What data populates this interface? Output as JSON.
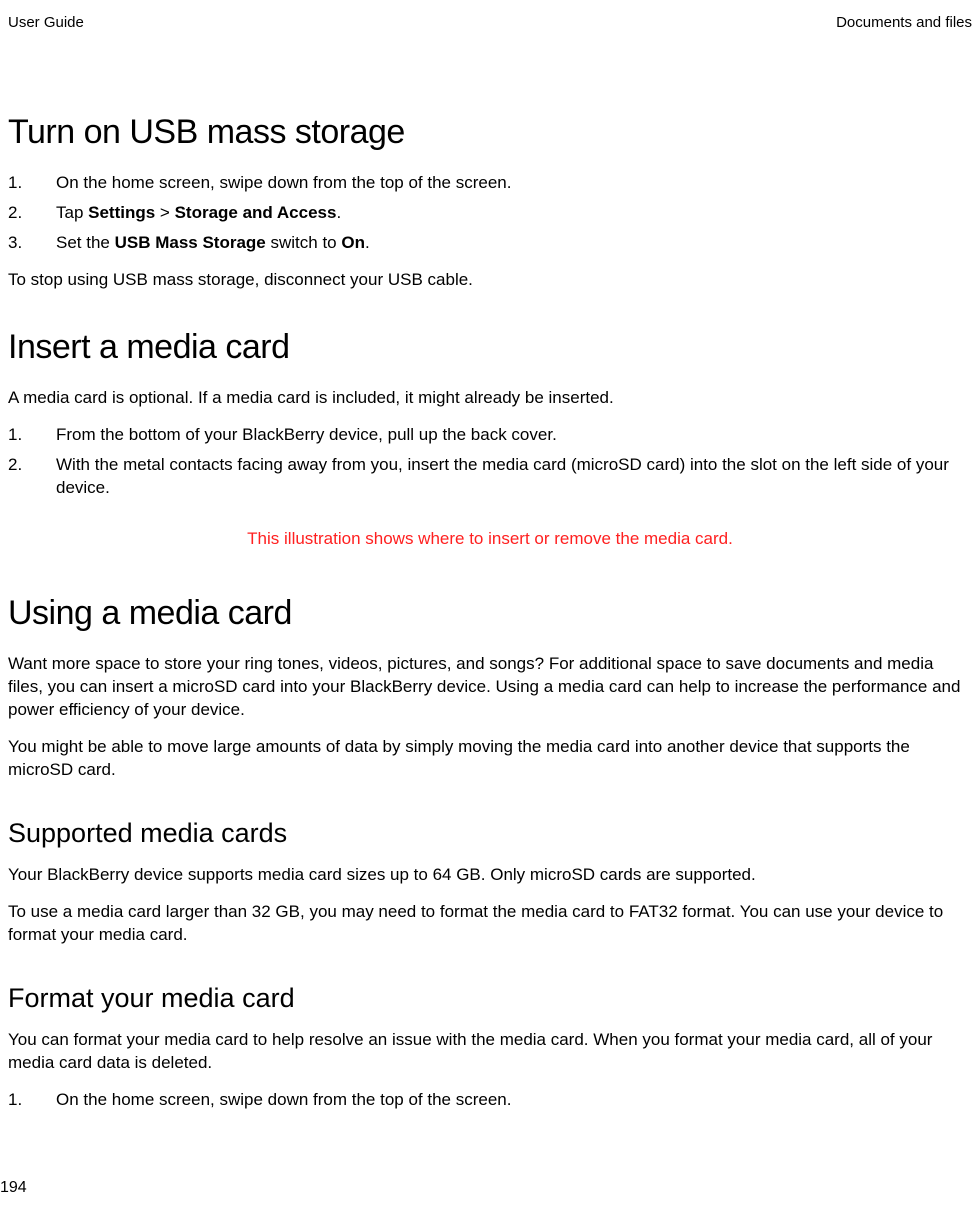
{
  "header": {
    "left": "User Guide",
    "right": "Documents and files"
  },
  "section1": {
    "title": "Turn on USB mass storage",
    "step1": "On the home screen, swipe down from the top of the screen.",
    "step2_pre": "Tap ",
    "step2_b1": "Settings",
    "step2_mid": " > ",
    "step2_b2": "Storage and Access",
    "step2_post": ".",
    "step3_pre": "Set the ",
    "step3_b1": "USB Mass Storage",
    "step3_mid": " switch to ",
    "step3_b2": "On",
    "step3_post": ".",
    "note": "To stop using USB mass storage, disconnect your USB cable."
  },
  "section2": {
    "title": "Insert a media card",
    "intro": "A media card is optional. If a media card is included, it might already be inserted.",
    "step1": "From the bottom of your BlackBerry device, pull up the back cover.",
    "step2": "With the metal contacts facing away from you, insert the media card (microSD card) into the slot on the left side of your device.",
    "caption": "This illustration shows where to insert or remove the media card."
  },
  "section3": {
    "title": "Using a media card",
    "p1": "Want more space to store your ring tones, videos, pictures, and songs? For additional space to save documents and media files, you can insert a microSD card into your BlackBerry device. Using a media card can help to increase the performance and power efficiency of your device.",
    "p2": "You might be able to move large amounts of data by simply moving the media card into another device that supports the microSD card."
  },
  "section4": {
    "title": "Supported media cards",
    "p1": "Your BlackBerry device supports media card sizes up to 64 GB. Only microSD cards are supported.",
    "p2": "To use a media card larger than 32 GB, you may need to format the media card to FAT32 format. You can use your device to format your media card."
  },
  "section5": {
    "title": "Format your media card",
    "p1": "You can format your media card to help resolve an issue with the media card. When you format your media card, all of your media card data is deleted.",
    "step1": "On the home screen, swipe down from the top of the screen."
  },
  "pageNumber": "194"
}
